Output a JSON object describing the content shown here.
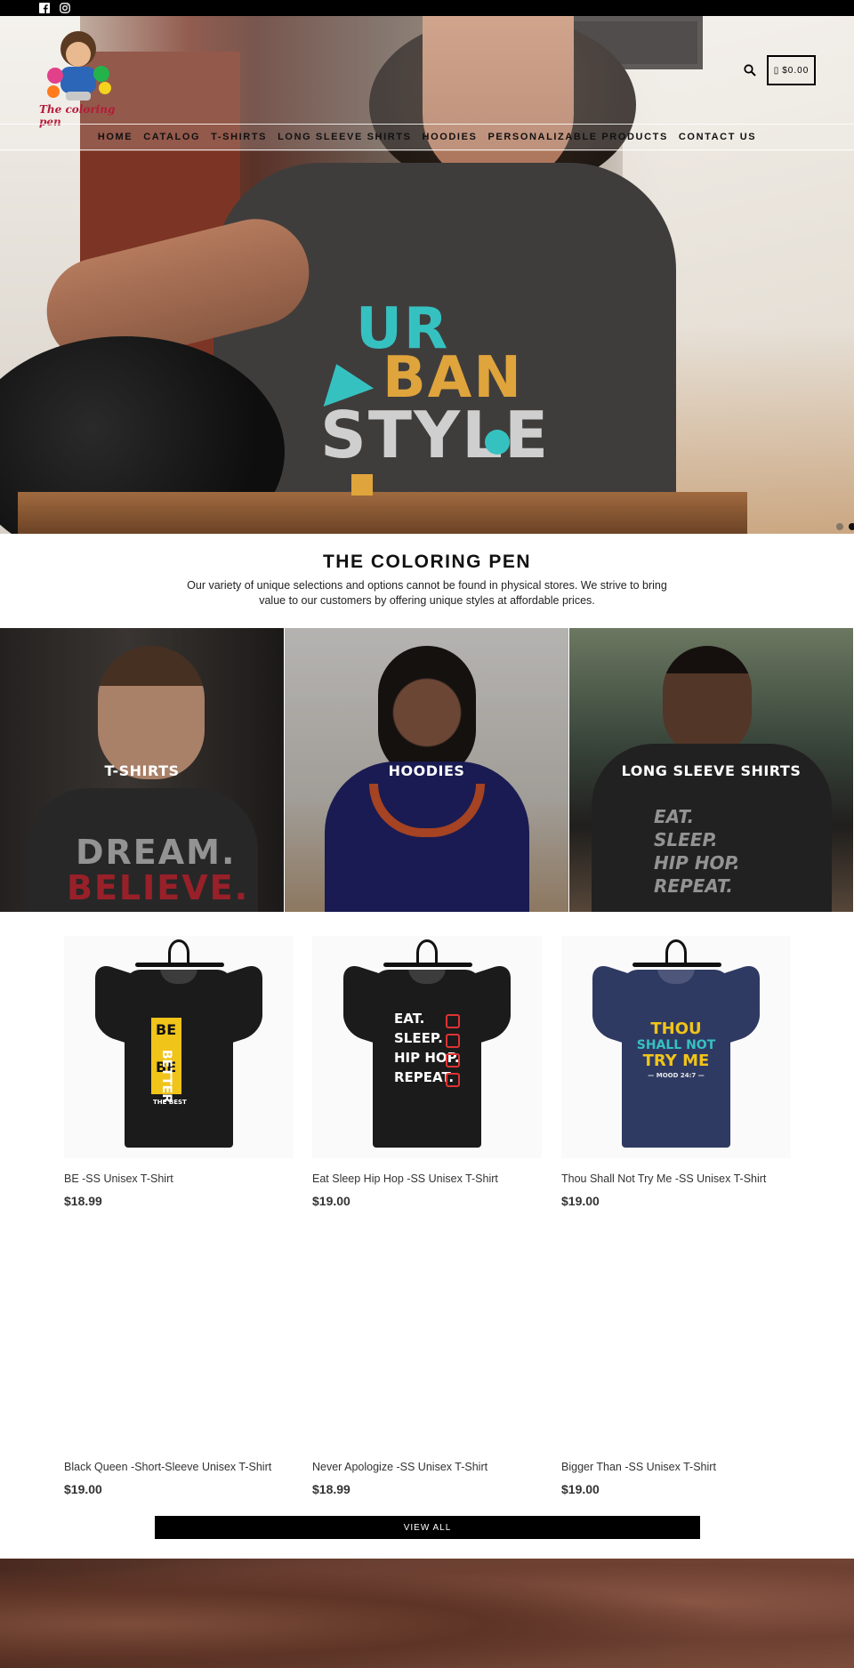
{
  "topbar": {
    "social": [
      "facebook-icon",
      "instagram-icon"
    ]
  },
  "header": {
    "logo_text": "The coloring pen",
    "cart_total": "$0.00",
    "search_icon": "search-icon",
    "cart_icon": "cart-icon"
  },
  "nav": {
    "items": [
      {
        "label": "HOME"
      },
      {
        "label": "CATALOG"
      },
      {
        "label": "T-SHIRTS"
      },
      {
        "label": "LONG SLEEVE SHIRTS"
      },
      {
        "label": "HOODIES"
      },
      {
        "label": "PERSONALIZABLE PRODUCTS"
      },
      {
        "label": "CONTACT US"
      }
    ]
  },
  "hero": {
    "shirt_print": [
      "UR",
      "BAN",
      "STYLE"
    ],
    "slides": 2,
    "active_slide": 2
  },
  "intro": {
    "title": "THE COLORING PEN",
    "text": "Our variety of unique selections and options cannot be found in physical stores. We strive to bring value to our customers by offering unique styles at affordable prices."
  },
  "collections": [
    {
      "label": "T-SHIRTS",
      "shirt_text": [
        "DREAM.",
        "BELIEVE."
      ]
    },
    {
      "label": "HOODIES"
    },
    {
      "label": "LONG SLEEVE SHIRTS",
      "shirt_text": [
        "EAT.",
        "SLEEP.",
        "HIP HOP.",
        "REPEAT."
      ]
    }
  ],
  "products": [
    {
      "title": "BE -SS Unisex T-Shirt",
      "price": "$18.99",
      "print": [
        "BE",
        "BE",
        "BETTER",
        "THE BEST"
      ]
    },
    {
      "title": "Eat Sleep Hip Hop -SS Unisex T-Shirt",
      "price": "$19.00",
      "print": [
        "EAT.",
        "SLEEP.",
        "HIP HOP.",
        "REPEAT."
      ]
    },
    {
      "title": "Thou Shall Not Try Me -SS Unisex T-Shirt",
      "price": "$19.00",
      "print": [
        "THOU",
        "SHALL NOT",
        "TRY ME",
        "— MOOD 24:7 —"
      ]
    },
    {
      "title": "Black Queen -Short-Sleeve Unisex T-Shirt",
      "price": "$19.00"
    },
    {
      "title": "Never Apologize -SS Unisex T-Shirt",
      "price": "$18.99"
    },
    {
      "title": "Bigger Than -SS Unisex T-Shirt",
      "price": "$19.00"
    }
  ],
  "view_all_label": "VIEW ALL",
  "colors": {
    "accent": "#000000",
    "shirt_navy": "#2f3a63",
    "shirt_black": "#1b1b1b",
    "yellow": "#f0c419",
    "teal": "#36c1c1",
    "orange": "#e0a43c"
  }
}
